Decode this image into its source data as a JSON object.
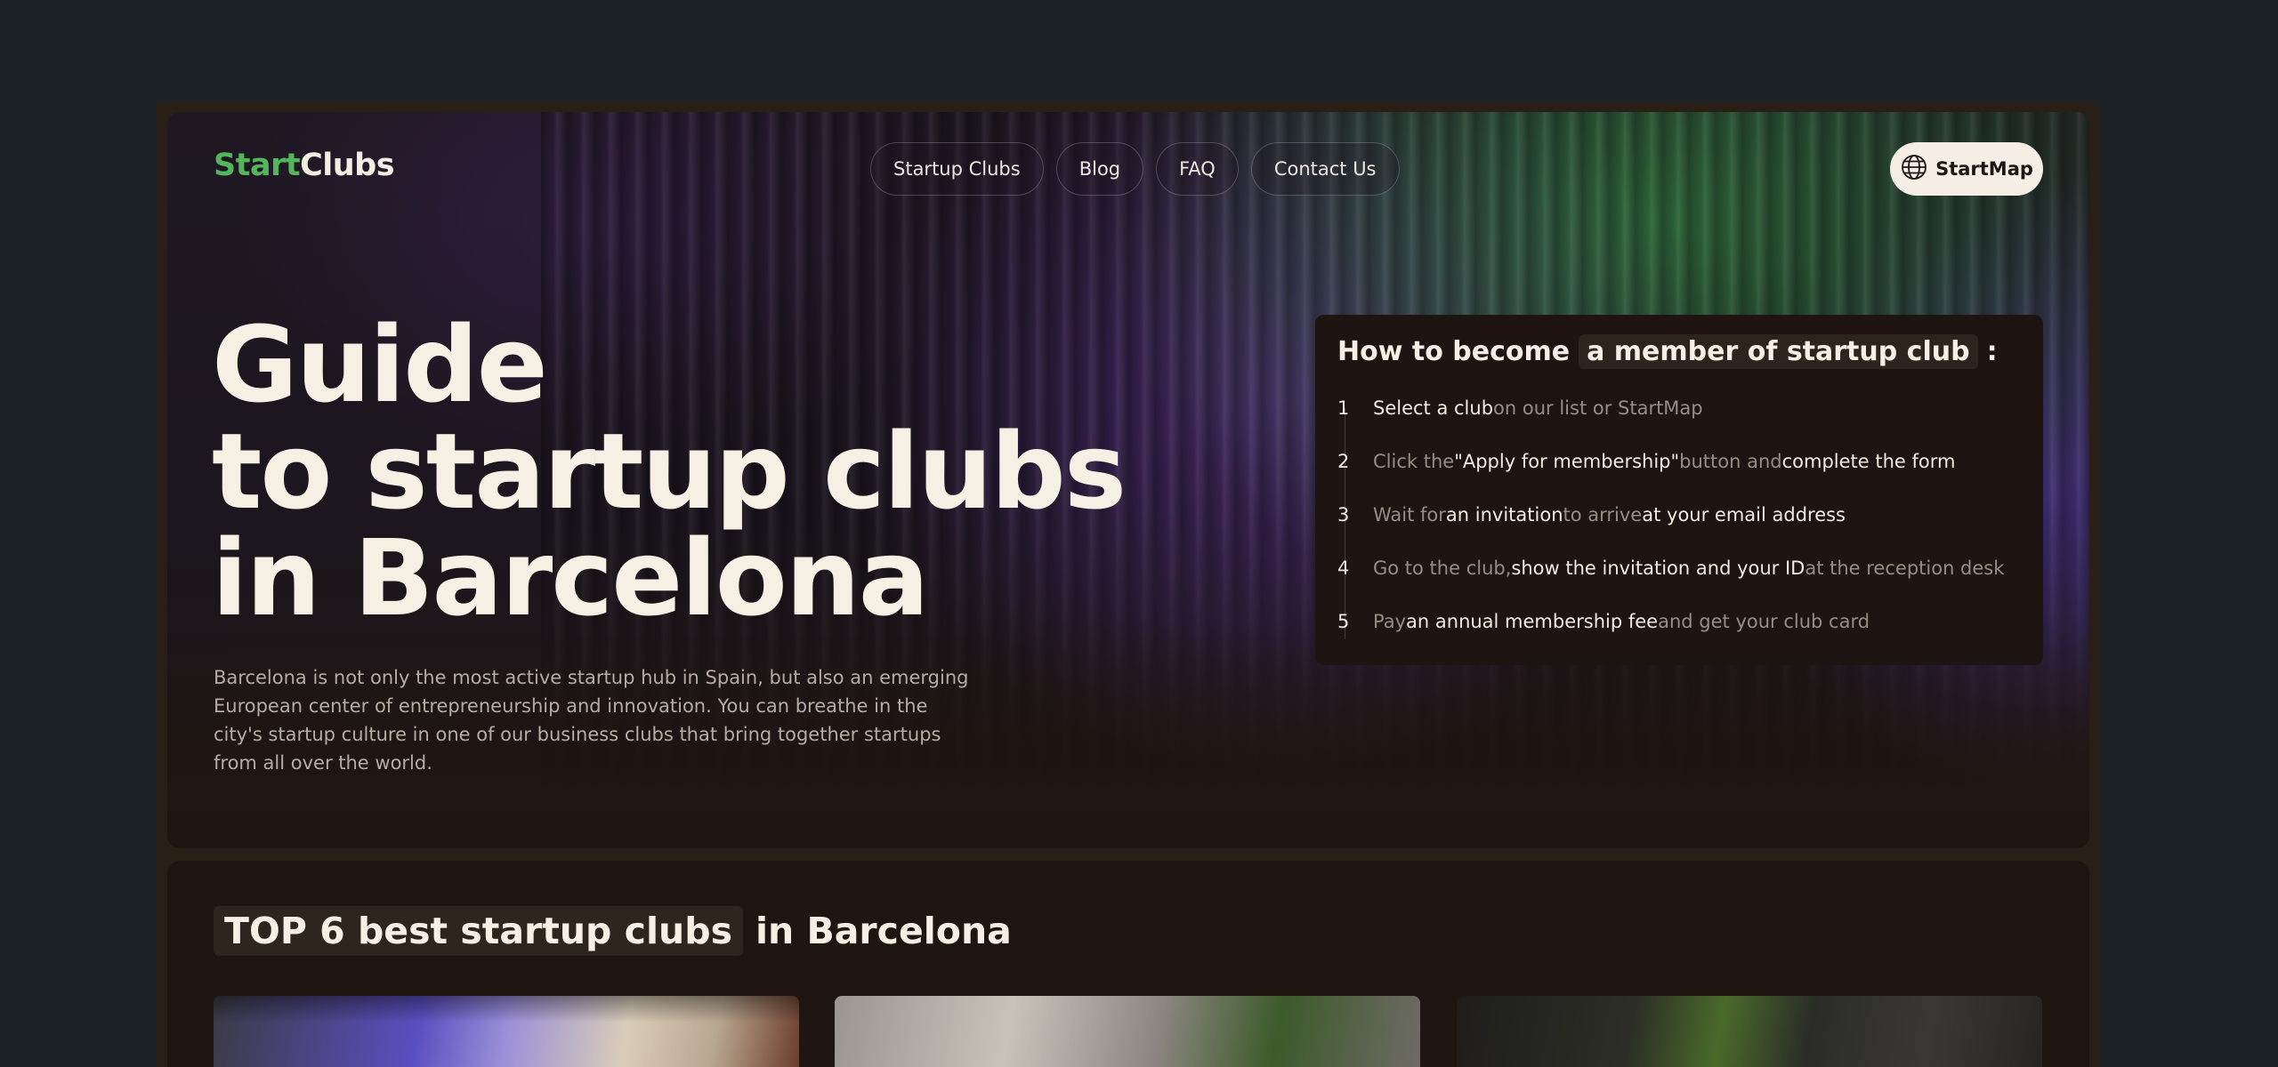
{
  "brand": {
    "part1": "Start",
    "part2": "Clubs"
  },
  "nav": {
    "items": [
      {
        "label": "Startup Clubs"
      },
      {
        "label": "Blog"
      },
      {
        "label": "FAQ"
      },
      {
        "label": "Contact Us"
      }
    ],
    "cta_label": "StartMap",
    "cta_icon": "globe-icon"
  },
  "hero": {
    "title_line1": "Guide",
    "title_line2": "to startup clubs",
    "title_line3": "in Barcelona",
    "intro": "Barcelona is not only the most active startup hub in Spain, but also an emerging European center of entrepreneurship and innovation. You can breathe in the city's startup culture in one of our business clubs that bring together startups from all over the world."
  },
  "howto": {
    "title_prefix": "How to become",
    "title_highlight": "a member of startup club",
    "title_suffix": ":",
    "steps": [
      {
        "num": "1",
        "a": "Select a club",
        "b": " on our list or StartMap",
        "c": "",
        "d": ""
      },
      {
        "num": "2",
        "a": "Click the ",
        "b": "\"Apply for membership\"",
        "c": " button and ",
        "d": "complete the form"
      },
      {
        "num": "3",
        "a": "Wait for ",
        "b": "an invitation",
        "c": " to arrive ",
        "d": "at your email address"
      },
      {
        "num": "4",
        "a": "Go to the club, ",
        "b": "show the invitation and your ID",
        "c": " at the reception desk",
        "d": ""
      },
      {
        "num": "5",
        "a": "Pay ",
        "b": "an annual membership fee",
        "c": " and get your club card",
        "d": ""
      }
    ]
  },
  "top": {
    "title_highlight": "TOP 6 best startup clubs",
    "title_rest": "in Barcelona"
  },
  "colors": {
    "background": "#1c2126",
    "panel": "#201611",
    "accent_green": "#55b55c",
    "text": "#f4ede2"
  }
}
